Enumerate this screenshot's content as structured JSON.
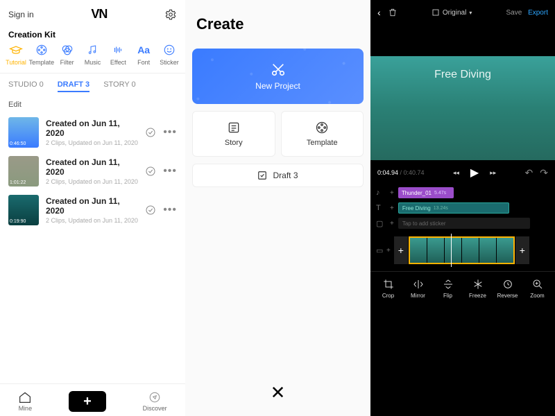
{
  "panel1": {
    "sign_in": "Sign in",
    "logo": "VN",
    "creation_kit": "Creation Kit",
    "kits": [
      {
        "label": "Tutorial"
      },
      {
        "label": "Template"
      },
      {
        "label": "Filter"
      },
      {
        "label": "Music"
      },
      {
        "label": "Effect"
      },
      {
        "label": "Font"
      },
      {
        "label": "Sticker"
      }
    ],
    "tabs": {
      "studio": "STUDIO 0",
      "draft": "DRAFT 3",
      "story": "STORY 0"
    },
    "edit": "Edit",
    "drafts": [
      {
        "title": "Created on Jun 11, 2020",
        "sub": "2 Clips, Updated on Jun 11, 2020",
        "dur": "0:46:50"
      },
      {
        "title": "Created on Jun 11, 2020",
        "sub": "2 Clips, Updated on Jun 11, 2020",
        "dur": "1:01:22"
      },
      {
        "title": "Created on Jun 11, 2020",
        "sub": "2 Clips, Updated on Jun 11, 2020",
        "dur": "0:19:90"
      }
    ],
    "bottom": {
      "mine": "Mine",
      "discover": "Discover"
    }
  },
  "panel2": {
    "title": "Create",
    "new_project": "New Project",
    "story": "Story",
    "template": "Template",
    "draft_card": "Draft 3"
  },
  "panel3": {
    "aspect": "Original",
    "save": "Save",
    "export": "Export",
    "preview_title": "Free Diving",
    "time_current": "0:04.94",
    "time_total": " / 0:40.74",
    "audio_clip": {
      "name": "Thunder_01",
      "dur": "5.47s"
    },
    "title_clip": {
      "name": "Free Diving",
      "dur": "13.24s"
    },
    "sticker_hint": "Tap to add sticker",
    "tools": [
      {
        "label": "Crop"
      },
      {
        "label": "Mirror"
      },
      {
        "label": "Flip"
      },
      {
        "label": "Freeze"
      },
      {
        "label": "Reverse"
      },
      {
        "label": "Zoom"
      }
    ]
  }
}
